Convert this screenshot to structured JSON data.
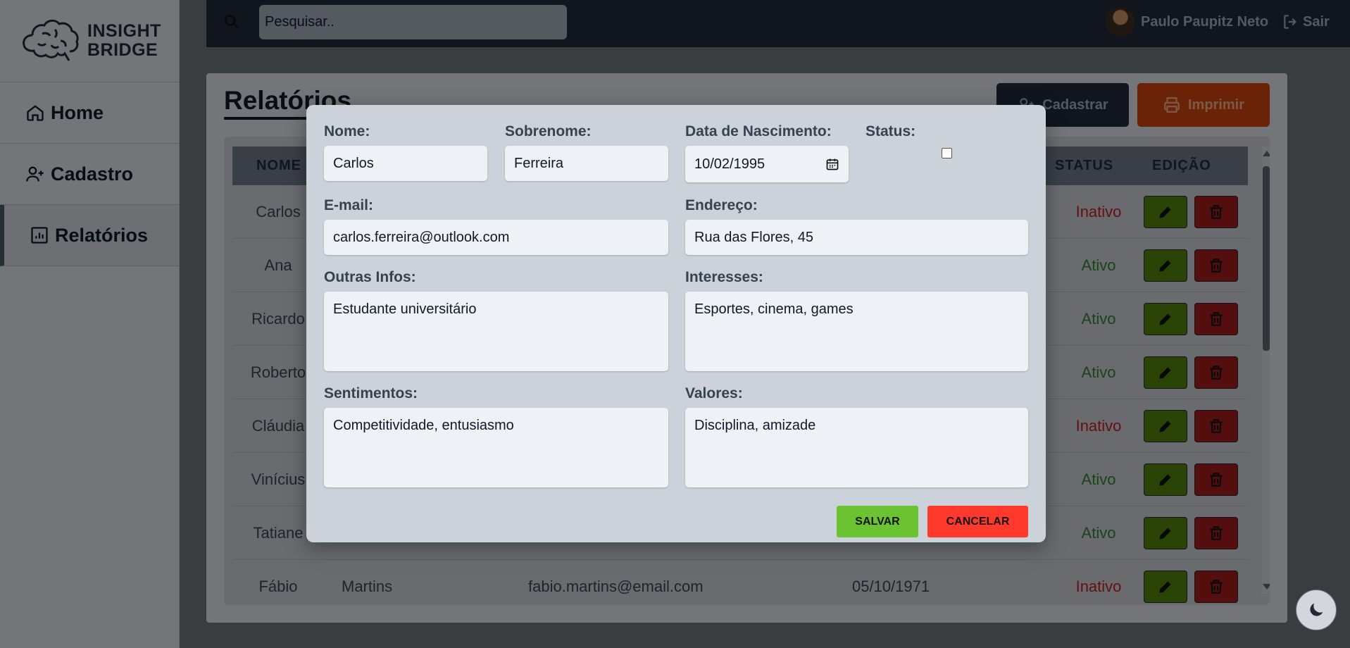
{
  "app": {
    "logo_line1": "INSIGHT",
    "logo_line2": "BRIDGE"
  },
  "sidebar": {
    "items": [
      {
        "label": "Home",
        "icon": "home-icon"
      },
      {
        "label": "Cadastro",
        "icon": "user-plus-icon"
      },
      {
        "label": "Relatórios",
        "icon": "report-icon",
        "active": true
      }
    ]
  },
  "topbar": {
    "search_placeholder": "Pesquisar..",
    "user_name": "Paulo Paupitz Neto",
    "logout_label": "Sair"
  },
  "page": {
    "title": "Relatórios",
    "btn_cadastrar": "Cadastrar",
    "btn_imprimir": "Imprimir"
  },
  "table": {
    "headers": [
      "NOME",
      "STATUS",
      "EDIÇÃO"
    ],
    "rows": [
      {
        "nome": "Carlos",
        "sobrenome": "",
        "email": "",
        "nascimento": "",
        "status": "Inativo"
      },
      {
        "nome": "Ana",
        "sobrenome": "",
        "email": "",
        "nascimento": "",
        "status": "Ativo"
      },
      {
        "nome": "Ricardo",
        "sobrenome": "",
        "email": "",
        "nascimento": "",
        "status": "Ativo"
      },
      {
        "nome": "Roberto",
        "sobrenome": "",
        "email": "",
        "nascimento": "",
        "status": "Ativo"
      },
      {
        "nome": "Cláudia",
        "sobrenome": "",
        "email": "",
        "nascimento": "",
        "status": "Inativo"
      },
      {
        "nome": "Vinícius",
        "sobrenome": "",
        "email": "",
        "nascimento": "",
        "status": "Ativo"
      },
      {
        "nome": "Tatiane",
        "sobrenome": "",
        "email": "",
        "nascimento": "",
        "status": "Ativo"
      },
      {
        "nome": "Fábio",
        "sobrenome": "Martins",
        "email": "fabio.martins@email.com",
        "nascimento": "05/10/1971",
        "status": "Inativo"
      }
    ]
  },
  "modal": {
    "nome_label": "Nome:",
    "nome_value": "Carlos",
    "sobrenome_label": "Sobrenome:",
    "sobrenome_value": "Ferreira",
    "nascimento_label": "Data de Nascimento:",
    "nascimento_value": "10/02/1995",
    "status_label": "Status:",
    "email_label": "E-mail:",
    "email_value": "carlos.ferreira@outlook.com",
    "endereco_label": "Endereço:",
    "endereco_value": "Rua das Flores, 45",
    "outras_label": "Outras Infos:",
    "outras_value": "Estudante universitário",
    "interesses_label": "Interesses:",
    "interesses_value": "Esportes, cinema, games",
    "sentimentos_label": "Sentimentos:",
    "sentimentos_value": "Competitividade, entusiasmo",
    "valores_label": "Valores:",
    "valores_value": "Disciplina, amizade",
    "save_label": "SALVAR",
    "cancel_label": "CANCELAR"
  },
  "colors": {
    "save": "#6cc332",
    "cancel": "#ff3a2d",
    "status_inativo": "#b91c1c",
    "status_ativo": "#2f7d2f"
  }
}
